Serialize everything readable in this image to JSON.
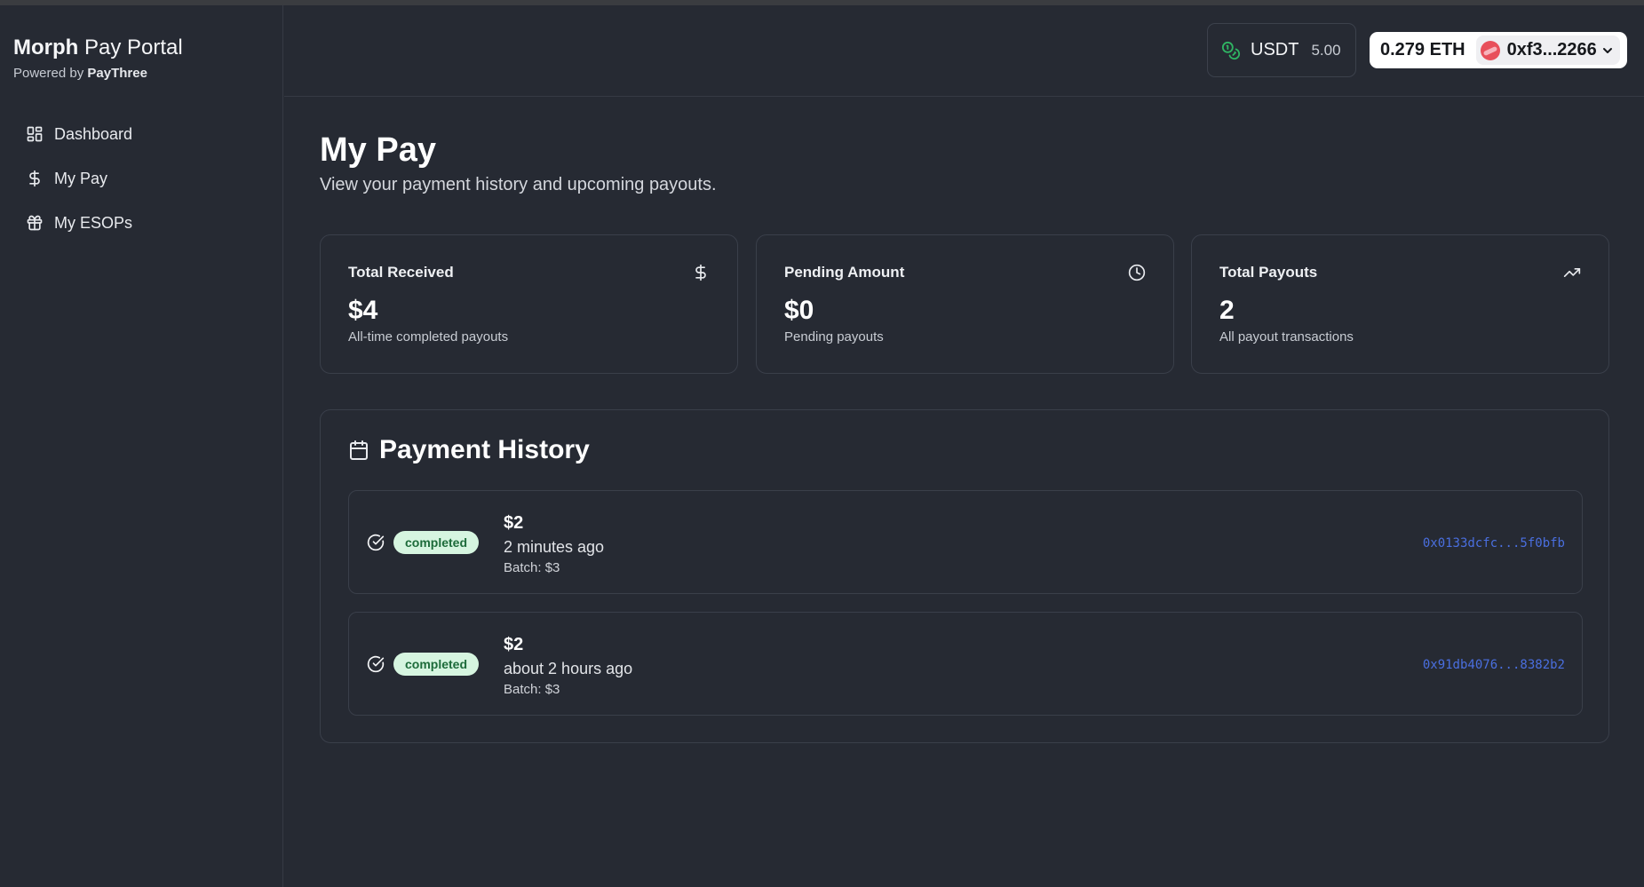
{
  "brand": {
    "name_bold": "Morph",
    "name_rest": " Pay Portal",
    "powered_by": "Powered by ",
    "powered_by_name": "PayThree"
  },
  "sidebar": {
    "items": [
      {
        "label": "Dashboard",
        "icon": "layout-dashboard-icon"
      },
      {
        "label": "My Pay",
        "icon": "dollar-sign-icon"
      },
      {
        "label": "My ESOPs",
        "icon": "gift-icon"
      }
    ]
  },
  "header": {
    "token": {
      "name": "USDT",
      "value": "5.00",
      "icon": "coins-icon"
    },
    "wallet": {
      "balance": "0.279 ETH",
      "address": "0xf3...2266"
    }
  },
  "page": {
    "title": "My Pay",
    "subtitle": "View your payment history and upcoming payouts."
  },
  "stats": [
    {
      "label": "Total Received",
      "value": "$4",
      "description": "All-time completed payouts",
      "icon": "dollar-sign-icon"
    },
    {
      "label": "Pending Amount",
      "value": "$0",
      "description": "Pending payouts",
      "icon": "clock-icon"
    },
    {
      "label": "Total Payouts",
      "value": "2",
      "description": "All payout transactions",
      "icon": "trending-up-icon"
    }
  ],
  "history": {
    "title": "Payment History",
    "rows": [
      {
        "status": "completed",
        "amount": "$2",
        "time": "2 minutes ago",
        "batch": "Batch: $3",
        "tx": "0x0133dcfc...5f0bfb"
      },
      {
        "status": "completed",
        "amount": "$2",
        "time": "about 2 hours ago",
        "batch": "Batch: $3",
        "tx": "0x91db4076...8382b2"
      }
    ]
  },
  "colors": {
    "background": "#262a33",
    "badge_bg": "#d6f5e0",
    "badge_text": "#1d6b3a",
    "link": "#4a6fe0",
    "token_icon": "#2fb463",
    "avatar": "#e8505b"
  }
}
